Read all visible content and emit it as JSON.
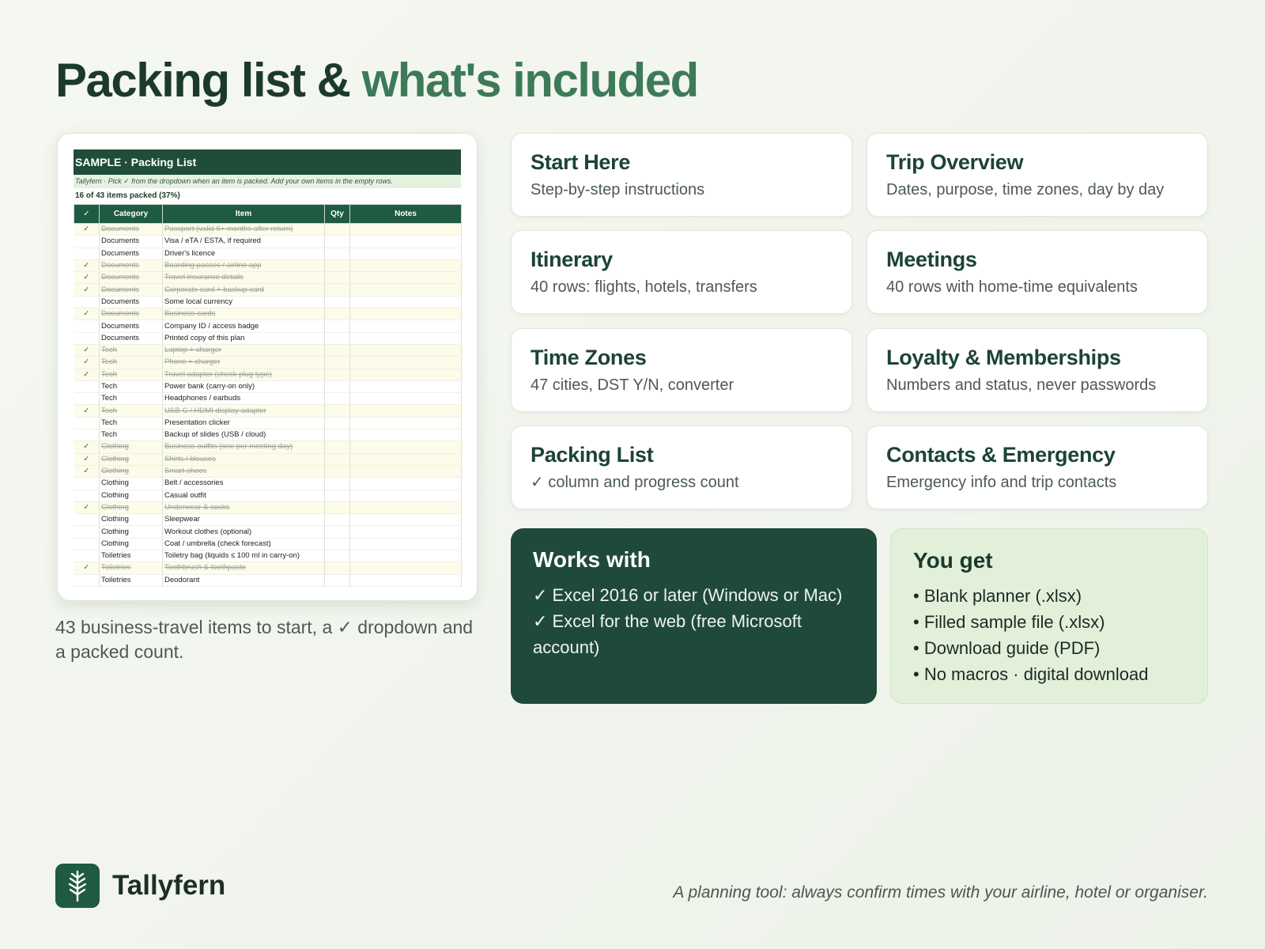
{
  "title": {
    "main": "Packing list &",
    "accent": "what's included"
  },
  "sheet": {
    "title": "SAMPLE · Packing List",
    "note": "Tallyfern · Pick ✓ from the dropdown when an item is packed. Add your own items in the empty rows.",
    "progress": "16 of 43 items packed (37%)",
    "headers": [
      "✓",
      "Category",
      "Item",
      "Qty",
      "Notes"
    ],
    "rows": [
      {
        "check": "✓",
        "category": "Documents",
        "item": "Passport (valid 6+ months after return)"
      },
      {
        "check": "",
        "category": "Documents",
        "item": "Visa / eTA / ESTA, if required"
      },
      {
        "check": "",
        "category": "Documents",
        "item": "Driver's licence"
      },
      {
        "check": "✓",
        "category": "Documents",
        "item": "Boarding passes / airline app"
      },
      {
        "check": "✓",
        "category": "Documents",
        "item": "Travel insurance details"
      },
      {
        "check": "✓",
        "category": "Documents",
        "item": "Corporate card + backup card"
      },
      {
        "check": "",
        "category": "Documents",
        "item": "Some local currency"
      },
      {
        "check": "✓",
        "category": "Documents",
        "item": "Business cards"
      },
      {
        "check": "",
        "category": "Documents",
        "item": "Company ID / access badge"
      },
      {
        "check": "",
        "category": "Documents",
        "item": "Printed copy of this plan"
      },
      {
        "check": "✓",
        "category": "Tech",
        "item": "Laptop + charger"
      },
      {
        "check": "✓",
        "category": "Tech",
        "item": "Phone + charger"
      },
      {
        "check": "✓",
        "category": "Tech",
        "item": "Travel adapter (check plug type)"
      },
      {
        "check": "",
        "category": "Tech",
        "item": "Power bank (carry-on only)"
      },
      {
        "check": "",
        "category": "Tech",
        "item": "Headphones / earbuds"
      },
      {
        "check": "✓",
        "category": "Tech",
        "item": "USB-C / HDMI display adapter"
      },
      {
        "check": "",
        "category": "Tech",
        "item": "Presentation clicker"
      },
      {
        "check": "",
        "category": "Tech",
        "item": "Backup of slides (USB / cloud)"
      },
      {
        "check": "✓",
        "category": "Clothing",
        "item": "Business outfits (one per meeting day)"
      },
      {
        "check": "✓",
        "category": "Clothing",
        "item": "Shirts / blouses"
      },
      {
        "check": "✓",
        "category": "Clothing",
        "item": "Smart shoes"
      },
      {
        "check": "",
        "category": "Clothing",
        "item": "Belt / accessories"
      },
      {
        "check": "",
        "category": "Clothing",
        "item": "Casual outfit"
      },
      {
        "check": "✓",
        "category": "Clothing",
        "item": "Underwear & socks"
      },
      {
        "check": "",
        "category": "Clothing",
        "item": "Sleepwear"
      },
      {
        "check": "",
        "category": "Clothing",
        "item": "Workout clothes (optional)"
      },
      {
        "check": "",
        "category": "Clothing",
        "item": "Coat / umbrella (check forecast)"
      },
      {
        "check": "",
        "category": "Toiletries",
        "item": "Toiletry bag (liquids ≤ 100 ml in carry-on)"
      },
      {
        "check": "✓",
        "category": "Toiletries",
        "item": "Toothbrush & toothpaste"
      },
      {
        "check": "",
        "category": "Toiletries",
        "item": "Deodorant"
      }
    ]
  },
  "caption": "43 business-travel items to start, a ✓ dropdown and a packed count.",
  "features": [
    {
      "title": "Start Here",
      "desc": "Step-by-step instructions"
    },
    {
      "title": "Trip Overview",
      "desc": "Dates, purpose, time zones, day by day"
    },
    {
      "title": "Itinerary",
      "desc": "40 rows: flights, hotels, transfers"
    },
    {
      "title": "Meetings",
      "desc": "40 rows with home-time equivalents"
    },
    {
      "title": "Time Zones",
      "desc": "47 cities, DST Y/N, converter"
    },
    {
      "title": "Loyalty & Memberships",
      "desc": "Numbers and status, never passwords"
    },
    {
      "title": "Packing List",
      "desc": "✓ column and progress count"
    },
    {
      "title": "Contacts & Emergency",
      "desc": "Emergency info and trip contacts"
    }
  ],
  "works_with": {
    "title": "Works with",
    "items": [
      "✓ Excel 2016 or later (Windows or Mac)",
      "✓ Excel for the web (free Microsoft account)"
    ]
  },
  "you_get": {
    "title": "You get",
    "items": [
      "• Blank planner (.xlsx)",
      "• Filled sample file (.xlsx)",
      "• Download guide (PDF)",
      "• No macros · digital download"
    ]
  },
  "footer": {
    "brand": "Tallyfern",
    "logo_icon": "fern-leaf-icon",
    "disclaimer": "A planning tool: always confirm times with your airline, hotel or organiser."
  },
  "colors": {
    "dark_green": "#1f4a3b",
    "accent_green": "#3d7a58",
    "light_green": "#e2f0da"
  }
}
